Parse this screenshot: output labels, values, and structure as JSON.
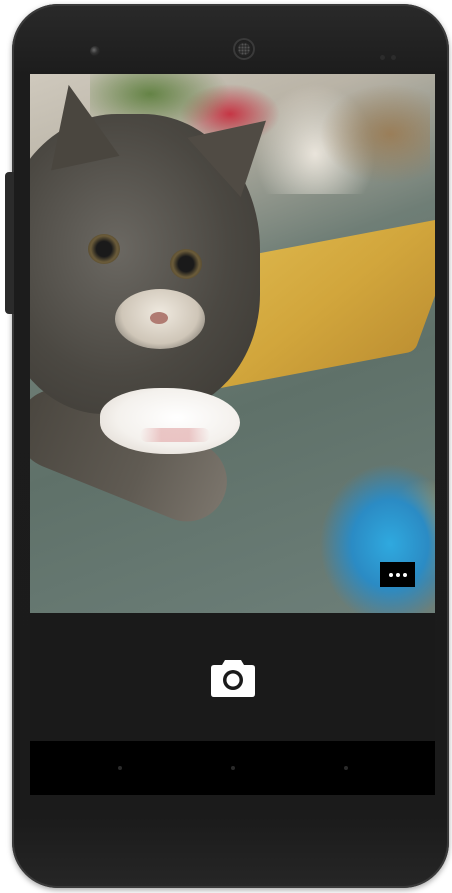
{
  "device": {
    "model_shape": "android-phone"
  },
  "preview": {
    "subject": ""
  },
  "overlay": {
    "more_options_icon": "more-horizontal-icon"
  },
  "controls": {
    "shutter_icon": "camera-icon"
  },
  "navbar": {
    "buttons": [
      "back-icon",
      "home-icon",
      "recents-icon"
    ]
  },
  "colors": {
    "screen_background": "#1a1a1a",
    "navbar_background": "#000000",
    "shutter_icon": "#ffffff",
    "more_button_background": "#000000"
  }
}
